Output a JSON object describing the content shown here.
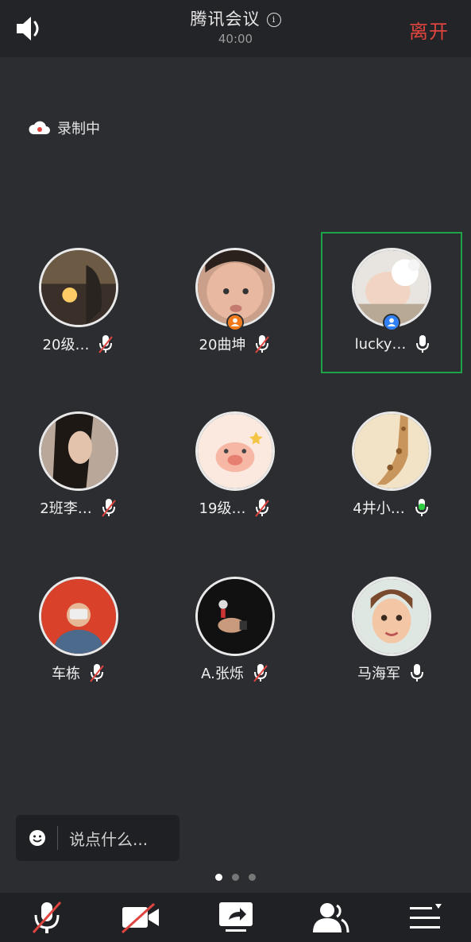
{
  "header": {
    "title": "腾讯会议",
    "timer": "40:00",
    "leave_label": "离开"
  },
  "recording": {
    "label": "录制中"
  },
  "participants": [
    {
      "name": "20级…",
      "mic": "muted",
      "badge": null,
      "active": false
    },
    {
      "name": "20曲坤",
      "mic": "muted",
      "badge": "orange",
      "active": false
    },
    {
      "name": "lucky…",
      "mic": "on",
      "badge": "blue",
      "active": true
    },
    {
      "name": "2班李…",
      "mic": "muted",
      "badge": null,
      "active": false
    },
    {
      "name": "19级…",
      "mic": "muted",
      "badge": null,
      "active": false
    },
    {
      "name": "4井小…",
      "mic": "speaking",
      "badge": null,
      "active": false
    },
    {
      "name": "车栋",
      "mic": "muted",
      "badge": null,
      "active": false
    },
    {
      "name": "A.张烁",
      "mic": "muted",
      "badge": null,
      "active": false
    },
    {
      "name": "马海军",
      "mic": "on",
      "badge": null,
      "active": false
    }
  ],
  "chat": {
    "placeholder": "说点什么..."
  },
  "pager": {
    "pages": 3,
    "current": 1
  },
  "toolbar": {
    "items": [
      {
        "icon": "mic-muted-icon"
      },
      {
        "icon": "camera-off-icon"
      },
      {
        "icon": "share-screen-icon"
      },
      {
        "icon": "participants-icon"
      },
      {
        "icon": "more-menu-icon"
      }
    ]
  },
  "colors": {
    "leave": "#e0443f",
    "speaking": "#2ecc40",
    "active_border": "#1fa34a",
    "host_orange": "#f07a1a",
    "cohost_blue": "#2f7ff6"
  }
}
